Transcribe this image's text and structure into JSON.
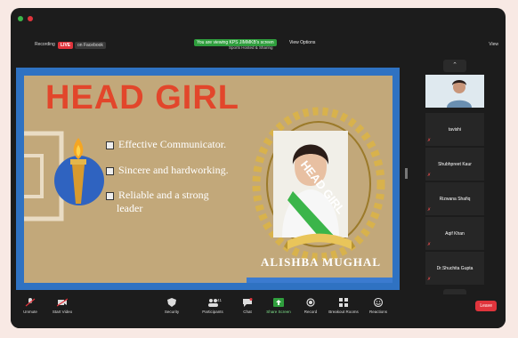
{
  "topbar": {
    "recording": "Recording",
    "live": "LIVE",
    "facebook": "on Facebook",
    "viewing_banner": "You are viewing KPS JIMMKB's screen",
    "viewing_sub": "Sports Hosted & Sharing",
    "view_options": "View Options",
    "view": "View"
  },
  "slide": {
    "title": "HEAD GIRL",
    "bullets": [
      "Effective Communicator.",
      "Sincere and hardworking.",
      "Reliable and a strong",
      "leader"
    ],
    "sash_text": "HEAD GIRL",
    "name": "ALISHBA MUGHAL"
  },
  "participants": [
    {
      "name": "",
      "self": true
    },
    {
      "name": "tavishi"
    },
    {
      "name": "Shubhpreet Kaur"
    },
    {
      "name": "Rizwana Shafiq"
    },
    {
      "name": "Aqif Khan"
    },
    {
      "name": "Dr.Shuchita Gupta"
    }
  ],
  "toolbar": {
    "unmute": "Unmute",
    "start_video": "Start Video",
    "security": "Security",
    "participants": "Participants",
    "participants_count": "41",
    "chat": "Chat",
    "share_screen": "Share Screen",
    "record": "Record",
    "breakout": "Breakout Rooms",
    "reactions": "Reactions",
    "leave": "Leave"
  },
  "colors": {
    "title_red": "#e2462b",
    "slide_border": "#2f72c2",
    "leave": "#e0343c",
    "share_green": "#2f9e3d"
  }
}
